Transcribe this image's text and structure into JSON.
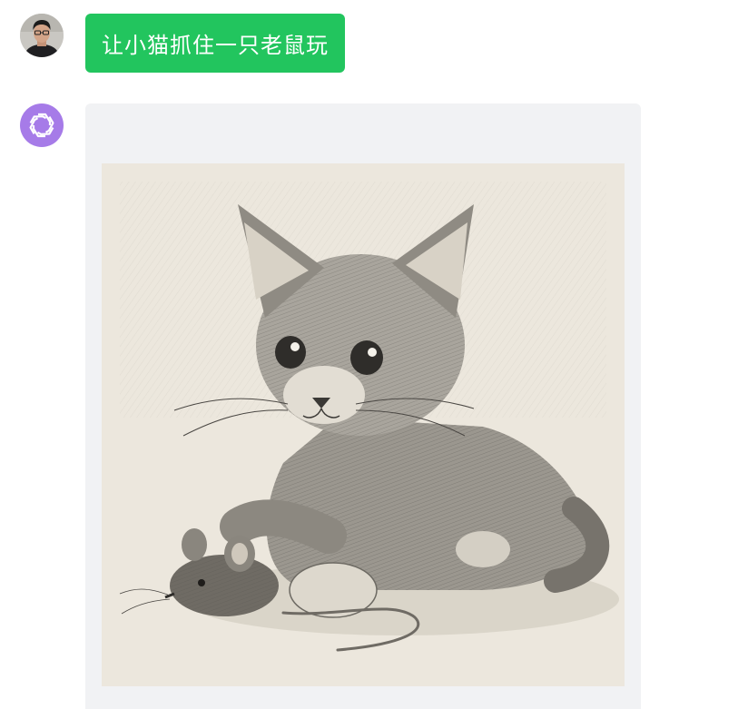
{
  "conversation": {
    "user_message": {
      "text": "让小猫抓住一只老鼠玩",
      "avatar_icon": "user-photo-avatar",
      "bubble_color": "#22c55e"
    },
    "assistant_message": {
      "avatar_icon": "openai-logo-icon",
      "avatar_color": "#a67be8",
      "bubble_color": "#f1f2f4",
      "image": {
        "kind": "pencil-sketch-illustration",
        "subject_icon": "kitten-with-mouse-sketch"
      }
    }
  }
}
